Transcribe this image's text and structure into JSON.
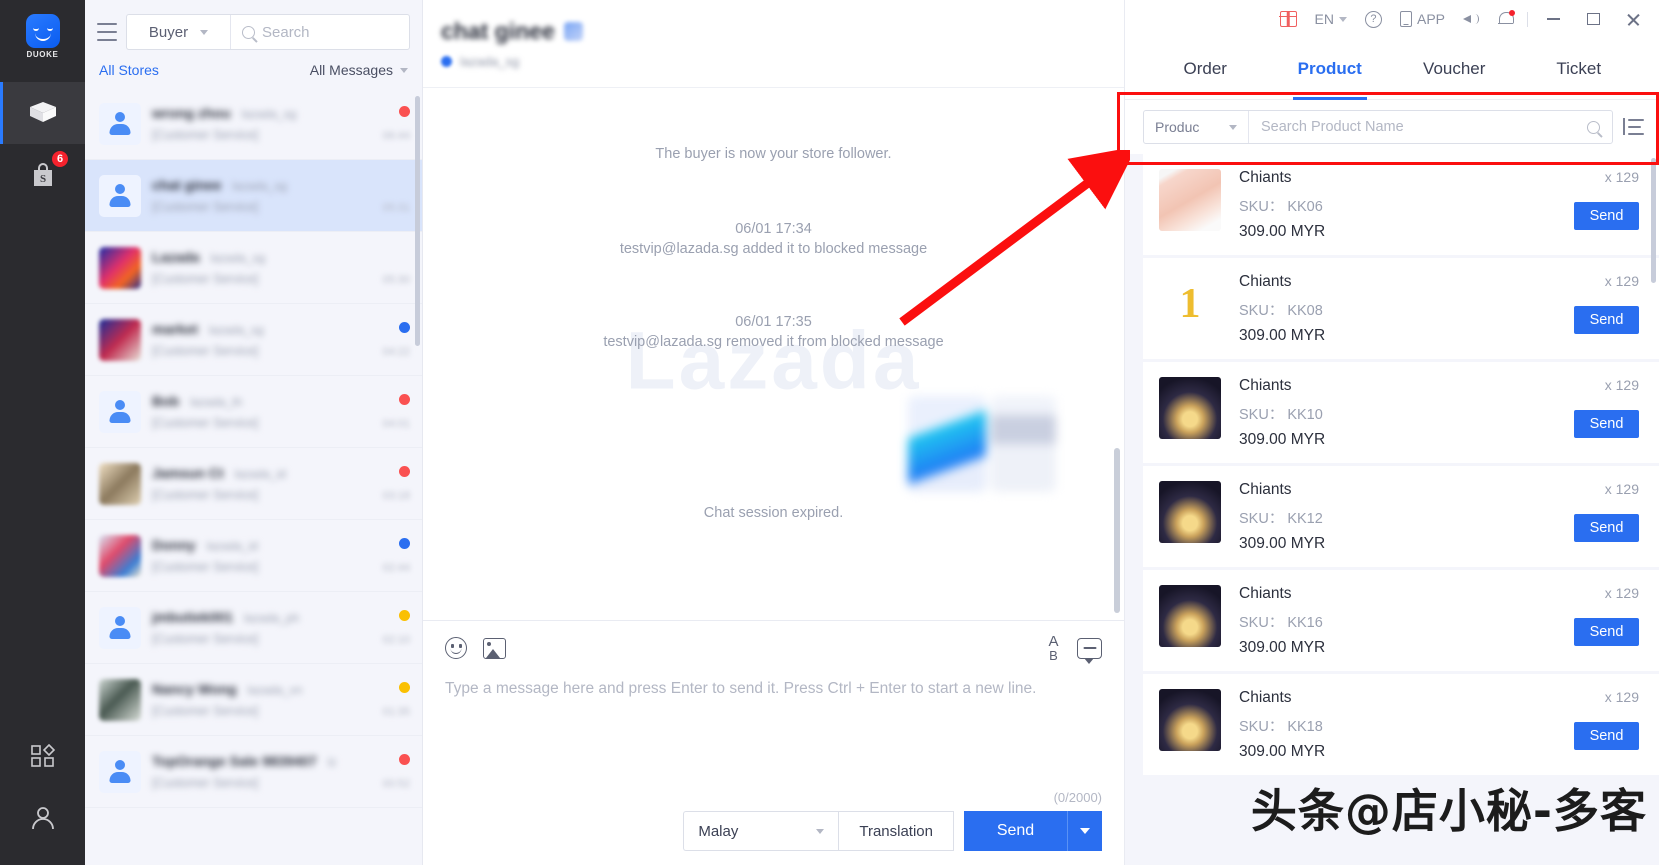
{
  "window": {
    "gift_label": "",
    "lang": "EN",
    "app_label": "APP",
    "minimize_label": "",
    "maximize_label": "",
    "close_label": ""
  },
  "rail": {
    "brand": "DUOKE",
    "items": [
      {
        "name": "packages",
        "badge": ""
      },
      {
        "name": "shopee-store",
        "badge": "6"
      },
      {
        "name": "apps",
        "badge": ""
      },
      {
        "name": "account",
        "badge": ""
      }
    ]
  },
  "conversations": {
    "filter_role": "Buyer",
    "search_placeholder": "Search",
    "all_stores": "All Stores",
    "all_messages": "All Messages",
    "items": [
      {
        "name": "wrong zhou",
        "shop": "lazada_sg",
        "preview": "[Customer Service]",
        "time": "06:44",
        "dot": "red",
        "avatar": "person",
        "selected": false
      },
      {
        "name": "chat ginee",
        "shop": "lazada_sg",
        "preview": "[Customer Service]",
        "time": "05:31",
        "dot": "",
        "avatar": "person",
        "selected": true
      },
      {
        "name": "Lazada",
        "shop": "lazada_sg",
        "preview": "[Customer Service]",
        "time": "05:30",
        "dot": "",
        "avatar": "image-a",
        "selected": false
      },
      {
        "name": "market",
        "shop": "lazada_sg",
        "preview": "[Customer Service]",
        "time": "04:22",
        "dot": "blue",
        "avatar": "image-b",
        "selected": false
      },
      {
        "name": "Bob",
        "shop": "lazada_th",
        "preview": "[Customer Service]",
        "time": "04:01",
        "dot": "red",
        "avatar": "person",
        "selected": false
      },
      {
        "name": "Jamsun Ct",
        "shop": "lazada_id",
        "preview": "[Customer Service]",
        "time": "03:18",
        "dot": "red",
        "avatar": "image-c",
        "selected": false
      },
      {
        "name": "Donny",
        "shop": "lazada_id",
        "preview": "[Customer Service]",
        "time": "02:44",
        "dot": "blue",
        "avatar": "image-d",
        "selected": false
      },
      {
        "name": "jmbutiek001",
        "shop": "lazada_ph",
        "preview": "[Customer Service]",
        "time": "02:10",
        "dot": "yellow",
        "avatar": "person",
        "selected": false
      },
      {
        "name": "Nancy Wong",
        "shop": "lazada_vn",
        "preview": "[Customer Service]",
        "time": "01:35",
        "dot": "yellow",
        "avatar": "image-e",
        "selected": false
      },
      {
        "name": "TopOrange Sale 9839407",
        "shop": "lz",
        "preview": "[Customer Service]",
        "time": "00:52",
        "dot": "red",
        "avatar": "person",
        "selected": false
      }
    ]
  },
  "chat": {
    "title": "chat ginee",
    "subtitle": "lazada_sg",
    "watermark": "Lazada",
    "messages": [
      {
        "type": "system",
        "text": "The buyer is now your store follower."
      },
      {
        "type": "system",
        "time": "06/01 17:34",
        "text": "testvip@lazada.sg added it to blocked message"
      },
      {
        "type": "system",
        "time": "06/01 17:35",
        "text": "testvip@lazada.sg removed it from blocked message"
      },
      {
        "type": "image",
        "text": ""
      },
      {
        "type": "system",
        "text": "Chat session expired."
      }
    ],
    "composer": {
      "placeholder": "Type a message here and press Enter to send it. Press Ctrl + Enter to start a new line.",
      "counter": "(0/2000)",
      "language": "Malay",
      "translation_label": "Translation",
      "send_label": "Send"
    }
  },
  "panel": {
    "tabs": [
      {
        "label": "Order",
        "active": false
      },
      {
        "label": "Product",
        "active": true
      },
      {
        "label": "Voucher",
        "active": false
      },
      {
        "label": "Ticket",
        "active": false
      }
    ],
    "filter_label": "Produc",
    "search_placeholder": "Search Product Name",
    "products": [
      {
        "name": "Chiants",
        "sku_label": "SKU：",
        "sku": "KK06",
        "price": "309.00 MYR",
        "qty": "x 129",
        "send": "Send",
        "thumb": "hands"
      },
      {
        "name": "Chiants",
        "sku_label": "SKU：",
        "sku": "KK08",
        "price": "309.00 MYR",
        "qty": "x 129",
        "send": "Send",
        "thumb": "one"
      },
      {
        "name": "Chiants",
        "sku_label": "SKU：",
        "sku": "KK10",
        "price": "309.00 MYR",
        "qty": "x 129",
        "send": "Send",
        "thumb": "night"
      },
      {
        "name": "Chiants",
        "sku_label": "SKU：",
        "sku": "KK12",
        "price": "309.00 MYR",
        "qty": "x 129",
        "send": "Send",
        "thumb": "night"
      },
      {
        "name": "Chiants",
        "sku_label": "SKU：",
        "sku": "KK16",
        "price": "309.00 MYR",
        "qty": "x 129",
        "send": "Send",
        "thumb": "night"
      },
      {
        "name": "Chiants",
        "sku_label": "SKU：",
        "sku": "KK18",
        "price": "309.00 MYR",
        "qty": "x 129",
        "send": "Send",
        "thumb": "night"
      }
    ]
  },
  "overlay": {
    "watermark": "头条@店小秘-多客",
    "highlight_color": "#fb0f0f"
  }
}
